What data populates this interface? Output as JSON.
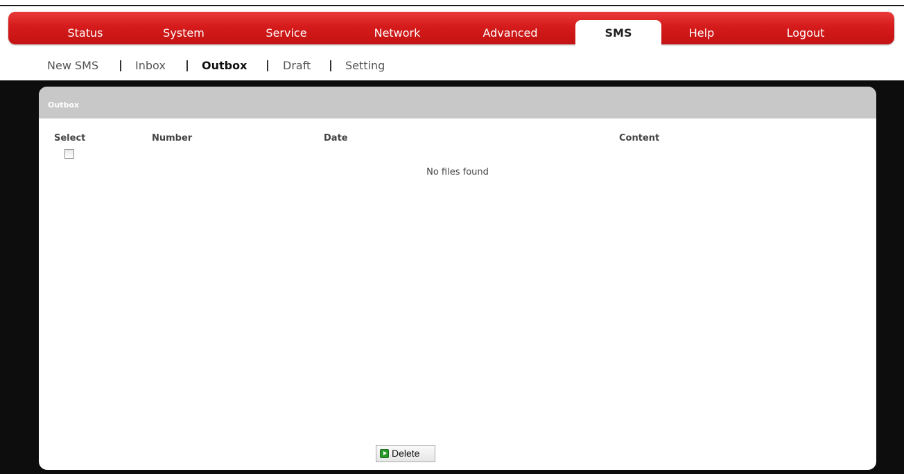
{
  "nav": {
    "items": [
      "Status",
      "System",
      "Service",
      "Network",
      "Advanced",
      "SMS",
      "Help",
      "Logout"
    ],
    "active": "SMS"
  },
  "subnav": {
    "items": [
      "New SMS",
      "Inbox",
      "Outbox",
      "Draft",
      "Setting"
    ],
    "active": "Outbox"
  },
  "panel": {
    "title": "Outbox",
    "columns": {
      "select": "Select",
      "number": "Number",
      "date": "Date",
      "content": "Content"
    },
    "empty_message": "No files found",
    "select_all_checked": false
  },
  "actions": {
    "delete_label": "Delete",
    "delete_icon": "play-green-icon"
  },
  "colors": {
    "nav_red": "#d51b1b",
    "panel_header": "#c8c8c8",
    "background_dark": "#0d0d0d"
  }
}
